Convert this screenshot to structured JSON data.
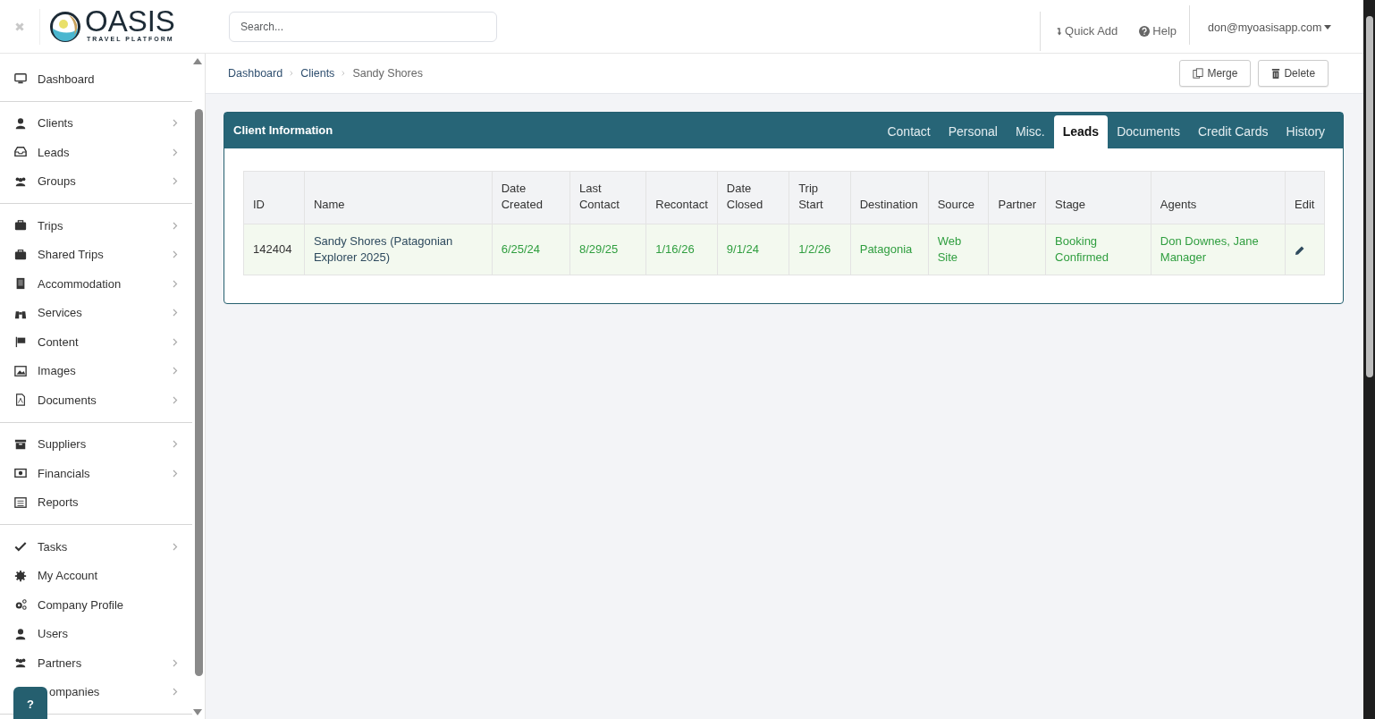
{
  "brand": {
    "name": "OASIS",
    "tagline": "TRAVEL PLATFORM"
  },
  "search": {
    "placeholder": "Search..."
  },
  "top_actions": [
    {
      "label": "Quick Add"
    },
    {
      "label": "Help"
    }
  ],
  "user_menu": {
    "label": "don@myoasisapp.com"
  },
  "sidebar": {
    "groups": [
      {
        "items": [
          {
            "label": "Dashboard",
            "has_submenu": false
          }
        ]
      },
      {
        "items": [
          {
            "label": "Clients",
            "has_submenu": true
          },
          {
            "label": "Leads",
            "has_submenu": true
          },
          {
            "label": "Groups",
            "has_submenu": true
          }
        ]
      },
      {
        "items": [
          {
            "label": "Trips",
            "has_submenu": true
          },
          {
            "label": "Shared Trips",
            "has_submenu": true
          },
          {
            "label": "Accommodation",
            "has_submenu": true
          },
          {
            "label": "Services",
            "has_submenu": true
          },
          {
            "label": "Content",
            "has_submenu": true
          },
          {
            "label": "Images",
            "has_submenu": true
          },
          {
            "label": "Documents",
            "has_submenu": true
          }
        ]
      },
      {
        "items": [
          {
            "label": "Suppliers",
            "has_submenu": true
          },
          {
            "label": "Financials",
            "has_submenu": true
          },
          {
            "label": "Reports",
            "has_submenu": false
          }
        ]
      },
      {
        "items": [
          {
            "label": "Tasks",
            "has_submenu": true
          },
          {
            "label": "My Account",
            "has_submenu": false
          },
          {
            "label": "Company Profile",
            "has_submenu": false
          },
          {
            "label": "Users",
            "has_submenu": false
          },
          {
            "label": "Partners",
            "has_submenu": true
          },
          {
            "label": "ompanies",
            "has_submenu": true
          }
        ]
      }
    ]
  },
  "help_button": {
    "label": "?"
  },
  "breadcrumb": [
    "Dashboard",
    "Clients",
    "Sandy Shores"
  ],
  "page_actions": [
    {
      "label": "Merge"
    },
    {
      "label": "Delete"
    }
  ],
  "card": {
    "title": "Client Information",
    "tabs": [
      {
        "label": "Contact",
        "selected": false
      },
      {
        "label": "Personal",
        "selected": false
      },
      {
        "label": "Misc.",
        "selected": false
      },
      {
        "label": "Leads",
        "selected": true
      },
      {
        "label": "Documents",
        "selected": false
      },
      {
        "label": "Credit Cards",
        "selected": false
      },
      {
        "label": "History",
        "selected": false
      }
    ],
    "table": {
      "columns": [
        [
          "ID"
        ],
        [
          "Name"
        ],
        [
          "Date",
          "Created"
        ],
        [
          "Last",
          "Contact"
        ],
        [
          "Recontact"
        ],
        [
          "Date",
          "Closed"
        ],
        [
          "Trip",
          "Start"
        ],
        [
          "Destination"
        ],
        [
          "Source"
        ],
        [
          "Partner"
        ],
        [
          "Stage"
        ],
        [
          "Agents"
        ],
        [
          "Edit"
        ]
      ],
      "rows": [
        {
          "id": "142404",
          "name": "Sandy Shores (Patagonian Explorer 2025)",
          "date_created": "6/25/24",
          "last_contact": "8/29/25",
          "recontact": "1/16/26",
          "date_closed": "9/1/24",
          "trip_start": "1/2/26",
          "destination": "Patagonia",
          "source": "Web Site",
          "stage": "Booking Confirmed",
          "agents": "Don Downes, Jane Manager"
        }
      ]
    }
  }
}
